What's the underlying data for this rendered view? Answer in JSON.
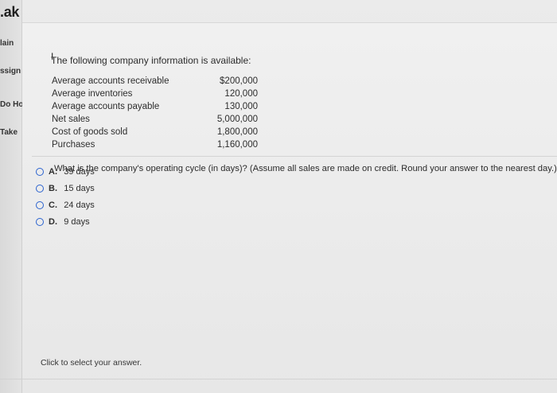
{
  "left_nav": {
    "brand": ".ak",
    "items": [
      {
        "label": "lain"
      },
      {
        "label": "ssign"
      },
      {
        "label": "Do Ho"
      },
      {
        "label": "Take"
      }
    ]
  },
  "question": {
    "intro": "The following company information is available:",
    "cursor_glyph": "I",
    "rows": [
      {
        "label": "Average accounts receivable",
        "value": "$200,000"
      },
      {
        "label": "Average inventories",
        "value": "120,000"
      },
      {
        "label": "Average accounts payable",
        "value": "130,000"
      },
      {
        "label": "Net sales",
        "value": "5,000,000"
      },
      {
        "label": "Cost of goods sold",
        "value": "1,800,000"
      },
      {
        "label": "Purchases",
        "value": "1,160,000"
      }
    ],
    "prompt": "What is the company's operating cycle (in days)? (Assume all sales are made on credit. Round your answer to the nearest day.)"
  },
  "choices": [
    {
      "letter": "A.",
      "text": "39 days"
    },
    {
      "letter": "B.",
      "text": "15 days"
    },
    {
      "letter": "C.",
      "text": "24 days"
    },
    {
      "letter": "D.",
      "text": "9 days"
    }
  ],
  "footer": {
    "hint": "Click to select your answer."
  },
  "colors": {
    "radio": "#2a62cf",
    "text": "#2b2b2b",
    "background": "#ebebeb"
  },
  "icons": {
    "cursor": "text-cursor-icon",
    "radio": "radio-button-icon"
  }
}
